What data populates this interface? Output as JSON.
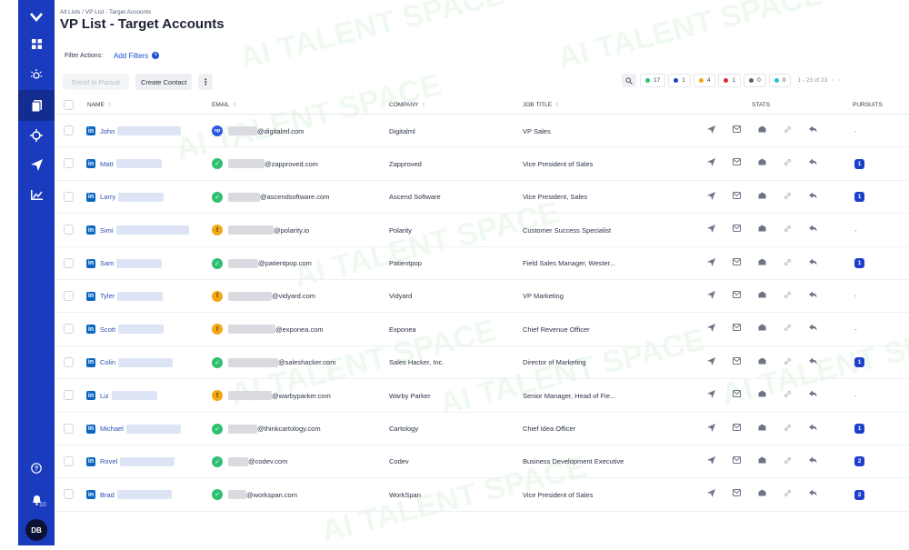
{
  "watermark": "AI TALENT SPACE",
  "sidebar": {
    "notification_count": "10",
    "avatar_initials": "DB"
  },
  "header": {
    "breadcrumb": "All Lists / VP List - Target Accounts",
    "title": "VP List - Target Accounts",
    "filter_label": "Filter Actions:",
    "add_filters_label": "Add Filters"
  },
  "toolbar": {
    "enroll_label": "Enroll In Pursuit",
    "create_contact_label": "Create Contact",
    "more_label": "⋮"
  },
  "stats_bar": {
    "chips": [
      {
        "count": "17",
        "color": "#2fbf71"
      },
      {
        "count": "1",
        "color": "#1d3fcc"
      },
      {
        "count": "4",
        "color": "#f3a712"
      },
      {
        "count": "1",
        "color": "#e0292f"
      },
      {
        "count": "0",
        "color": "#5b6270"
      },
      {
        "count": "0",
        "color": "#1ec6d6"
      }
    ],
    "pagination": "1 - 23 of 23"
  },
  "table": {
    "headers": {
      "name": "NAME",
      "email": "EMAIL",
      "company": "COMPANY",
      "job_title": "JOB TITLE",
      "stats": "STATS",
      "pursuits": "PURSUITS"
    },
    "rows": [
      {
        "name": "John",
        "email_domain": "@digitalml.com",
        "email_status": "np",
        "company": "Digitalml",
        "job_title": "VP Sales",
        "pursuits": "-"
      },
      {
        "name": "Matt",
        "email_domain": "@zapproved.com",
        "email_status": "valid",
        "company": "Zapproved",
        "job_title": "Vice President of Sales",
        "pursuits": "1"
      },
      {
        "name": "Larry",
        "email_domain": "@ascendsoftware.com",
        "email_status": "valid",
        "company": "Ascend Software",
        "job_title": "Vice President, Sales",
        "pursuits": "1"
      },
      {
        "name": "Simi",
        "email_domain": "@polarity.io",
        "email_status": "warn",
        "company": "Polarity",
        "job_title": "Customer Success Specialist",
        "pursuits": "-"
      },
      {
        "name": "Sam",
        "email_domain": "@patientpop.com",
        "email_status": "valid",
        "company": "Patientpop",
        "job_title": "Field Sales Manager, Wester...",
        "pursuits": "1"
      },
      {
        "name": "Tyler",
        "email_domain": "@vidyard.com",
        "email_status": "warn",
        "company": "Vidyard",
        "job_title": "VP Marketing",
        "pursuits": "-"
      },
      {
        "name": "Scott",
        "email_domain": "@exponea.com",
        "email_status": "warn",
        "company": "Exponea",
        "job_title": "Chief Revenue Officer",
        "pursuits": "-"
      },
      {
        "name": "Colin",
        "email_domain": "@saleshacker.com",
        "email_status": "valid",
        "company": "Sales Hacker, Inc.",
        "job_title": "Director of Marketing",
        "pursuits": "1"
      },
      {
        "name": "Liz",
        "email_domain": "@warbyparker.com",
        "email_status": "warn",
        "company": "Warby Parker",
        "job_title": "Senior Manager, Head of Fie...",
        "pursuits": "-"
      },
      {
        "name": "Michael",
        "email_domain": "@thinkcartology.com",
        "email_status": "valid",
        "company": "Cartology",
        "job_title": "Chief Idea Officer",
        "pursuits": "1"
      },
      {
        "name": "Rovel",
        "email_domain": "@codev.com",
        "email_status": "valid",
        "company": "Codev",
        "job_title": "Business Development Executive",
        "pursuits": "2"
      },
      {
        "name": "Brad",
        "email_domain": "@workspan.com",
        "email_status": "valid",
        "company": "WorkSpan",
        "job_title": "Vice President of Sales",
        "pursuits": "2"
      }
    ]
  }
}
